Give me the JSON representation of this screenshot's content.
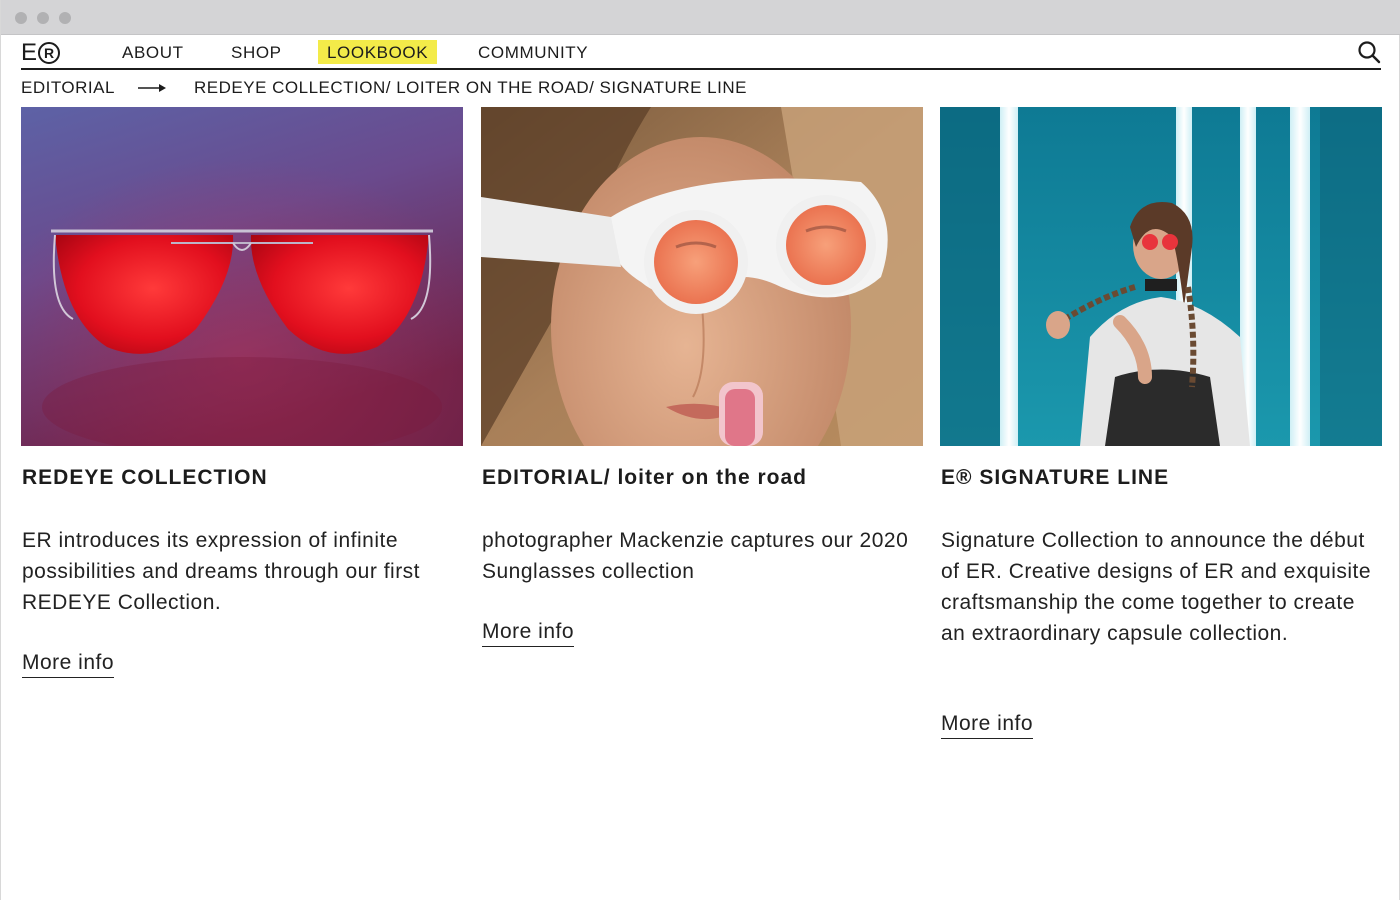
{
  "brand": {
    "logo_letter": "E",
    "logo_mark": "R"
  },
  "nav": {
    "items": [
      {
        "label": "ABOUT",
        "active": false
      },
      {
        "label": "SHOP",
        "active": false
      },
      {
        "label": "LOOKBOOK",
        "active": true
      },
      {
        "label": "COMMUNITY",
        "active": false
      }
    ]
  },
  "icons": {
    "search": "search-icon",
    "arrow": "arrow-right-icon"
  },
  "colors": {
    "highlight": "#f3eb49",
    "text": "#1c1c1c"
  },
  "breadcrumb": {
    "section": "EDITORIAL",
    "path": "REDEYE COLLECTION/  LOITER ON THE ROAD/ SIGNATURE LINE"
  },
  "cards": [
    {
      "title": "REDEYE COLLECTION",
      "description": "ER introduces its expression of infinite possibilities and dreams through our first REDEYE Collection.",
      "more": "More info"
    },
    {
      "title": "EDITORIAL/ loiter on the road",
      "description": "photographer Mackenzie captures our 2020 Sunglasses collection",
      "more": "More info"
    },
    {
      "title": "E® SIGNATURE LINE",
      "description": "Signature Collection to announce the début of ER. Creative designs of ER and exquisite craftsmanship the come together to create an extraordinary capsule collection.",
      "more": "More info"
    }
  ]
}
